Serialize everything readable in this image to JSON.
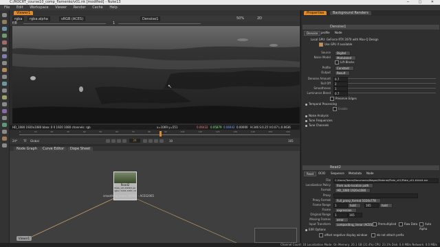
{
  "window": {
    "title": "C:/ROCRT_course10_comp_flamenko/v01.nk [modified] - Nuke13"
  },
  "menubar": [
    "File",
    "Edit",
    "Workspace",
    "Viewer",
    "Render",
    "Cache",
    "Help"
  ],
  "viewer": {
    "tab_label": "Viewer1",
    "layer": "rgba",
    "channel": "rgba.alpha",
    "colorspace": "sRGB (ACES)",
    "input_a": "Denoise1",
    "zoom": "50%",
    "gain": "f/8",
    "gamma": "1",
    "frame_ctrl": "2D",
    "info_left": "HD_1080 1920x1080  bbox: 0 0 1920 1080 channels: rgb",
    "info_coord": "x=1069 y=551",
    "info_val1": "0.06432",
    "info_val2": "0.05879",
    "info_val3": "0.06942",
    "info_val4": "0.00000",
    "info_hsv": "H:346 S:0.25 V:0.07 L:0.0636",
    "timeline_start": "1001",
    "timeline_end": "1165",
    "tick_labels": [
      "1",
      "10",
      "20",
      "30",
      "40",
      "50",
      "60",
      "70",
      "80",
      "90",
      "100",
      "110",
      "120",
      "130",
      "140",
      "150",
      "160"
    ],
    "fps_label": "24*",
    "tf_label": "TF",
    "global_label": "Global",
    "current_frame": "24",
    "frame_step": "10",
    "range_end": "165"
  },
  "node_graph": {
    "tabs": [
      "Node Graph",
      "Curve Editor",
      "Dope Sheet"
    ],
    "read_node": {
      "name": "Read2",
      "file": "Plate_v01.####.exr",
      "info": "rgba / 1001-1165 / ACES",
      "sub": "smoothing_linear (ACES) - ACES2065"
    },
    "denoise_label": "Denoise1",
    "viewer_node": "Viewer1"
  },
  "properties": {
    "tabs": [
      "Properties",
      "Background Renders"
    ],
    "denoise": {
      "title": "Denoise1",
      "subtabs": [
        "Denoise",
        "profile",
        "Node"
      ],
      "gpu_text": "Local GPU:  GeForce RTX 2070 with Max-Q Design",
      "use_gpu": "Use GPU if available",
      "source_label": "Source",
      "source_value": "Digital",
      "noise_model_label": "Noise Model",
      "noise_model_value": "Modulated",
      "lift_blacks": "Lift Blacks",
      "profile_label": "Profile",
      "profile_value": "Constant",
      "output_label": "Output",
      "output_value": "Result",
      "amount_label": "Denoise Amount",
      "amount_value": "0.7",
      "rolloff_label": "Roll Off",
      "rolloff_value": "2",
      "smooth_label": "Smoothness",
      "smooth_value": "1",
      "lum_label": "Luminance Blend",
      "lum_value": "0.7",
      "preserve": "Preserve Edges",
      "temporal": "Temporal Processing",
      "enable": "Enable",
      "noise_analysis": "Noise Analysis",
      "tune_freq": "Tune Frequencies",
      "tune_chan": "Tune Channels"
    },
    "read": {
      "title": "Read2",
      "subtabs": [
        "Read",
        "OCIO",
        "Sequence",
        "Metadata",
        "Node"
      ],
      "file_label": "File",
      "file_value": "C:/Users/Tomm/Documents/Wagon/Material/Plate_v01/Plate_v01.####.exr",
      "loc_label": "Localization Policy",
      "loc_value": "from auto-localize path",
      "format_label": "Format",
      "format_value": "HD_1080 1920x1080",
      "proxy_label": "Proxy",
      "proxy_format_label": "Proxy Format",
      "proxy_format_value": "Full_proxy_format 1024x778",
      "frame_range_label": "Frame Range",
      "frame_start": "1",
      "frame_end": "165",
      "hold": "hold",
      "frame_label": "Frame",
      "frame_value": "expression",
      "orig_range_label": "Original Range",
      "orig_start": "1",
      "orig_end": "165",
      "missing_label": "Missing Frames",
      "missing_value": "error",
      "input_transform_label": "Input Transform",
      "input_transform_value": "compositing_linear (ACES)",
      "premultiplied": "Premultiplied",
      "raw_data": "Raw Data",
      "auto_alpha": "Auto Alpha",
      "exr_options": "EXR Options",
      "offset_neg": "offset negative display window",
      "no_prefix": "do not attach prefix"
    }
  },
  "status": {
    "text": "Channel Count: 16  Localization Mode: On  Memory: 20.1 GB (31.4%)  CPU: 23.1%  Disk: 0.0 MB/s  Network: 0.0 MB/s"
  },
  "colors": {
    "accent": "#e38a2b",
    "bg": "#2b2b2b"
  }
}
